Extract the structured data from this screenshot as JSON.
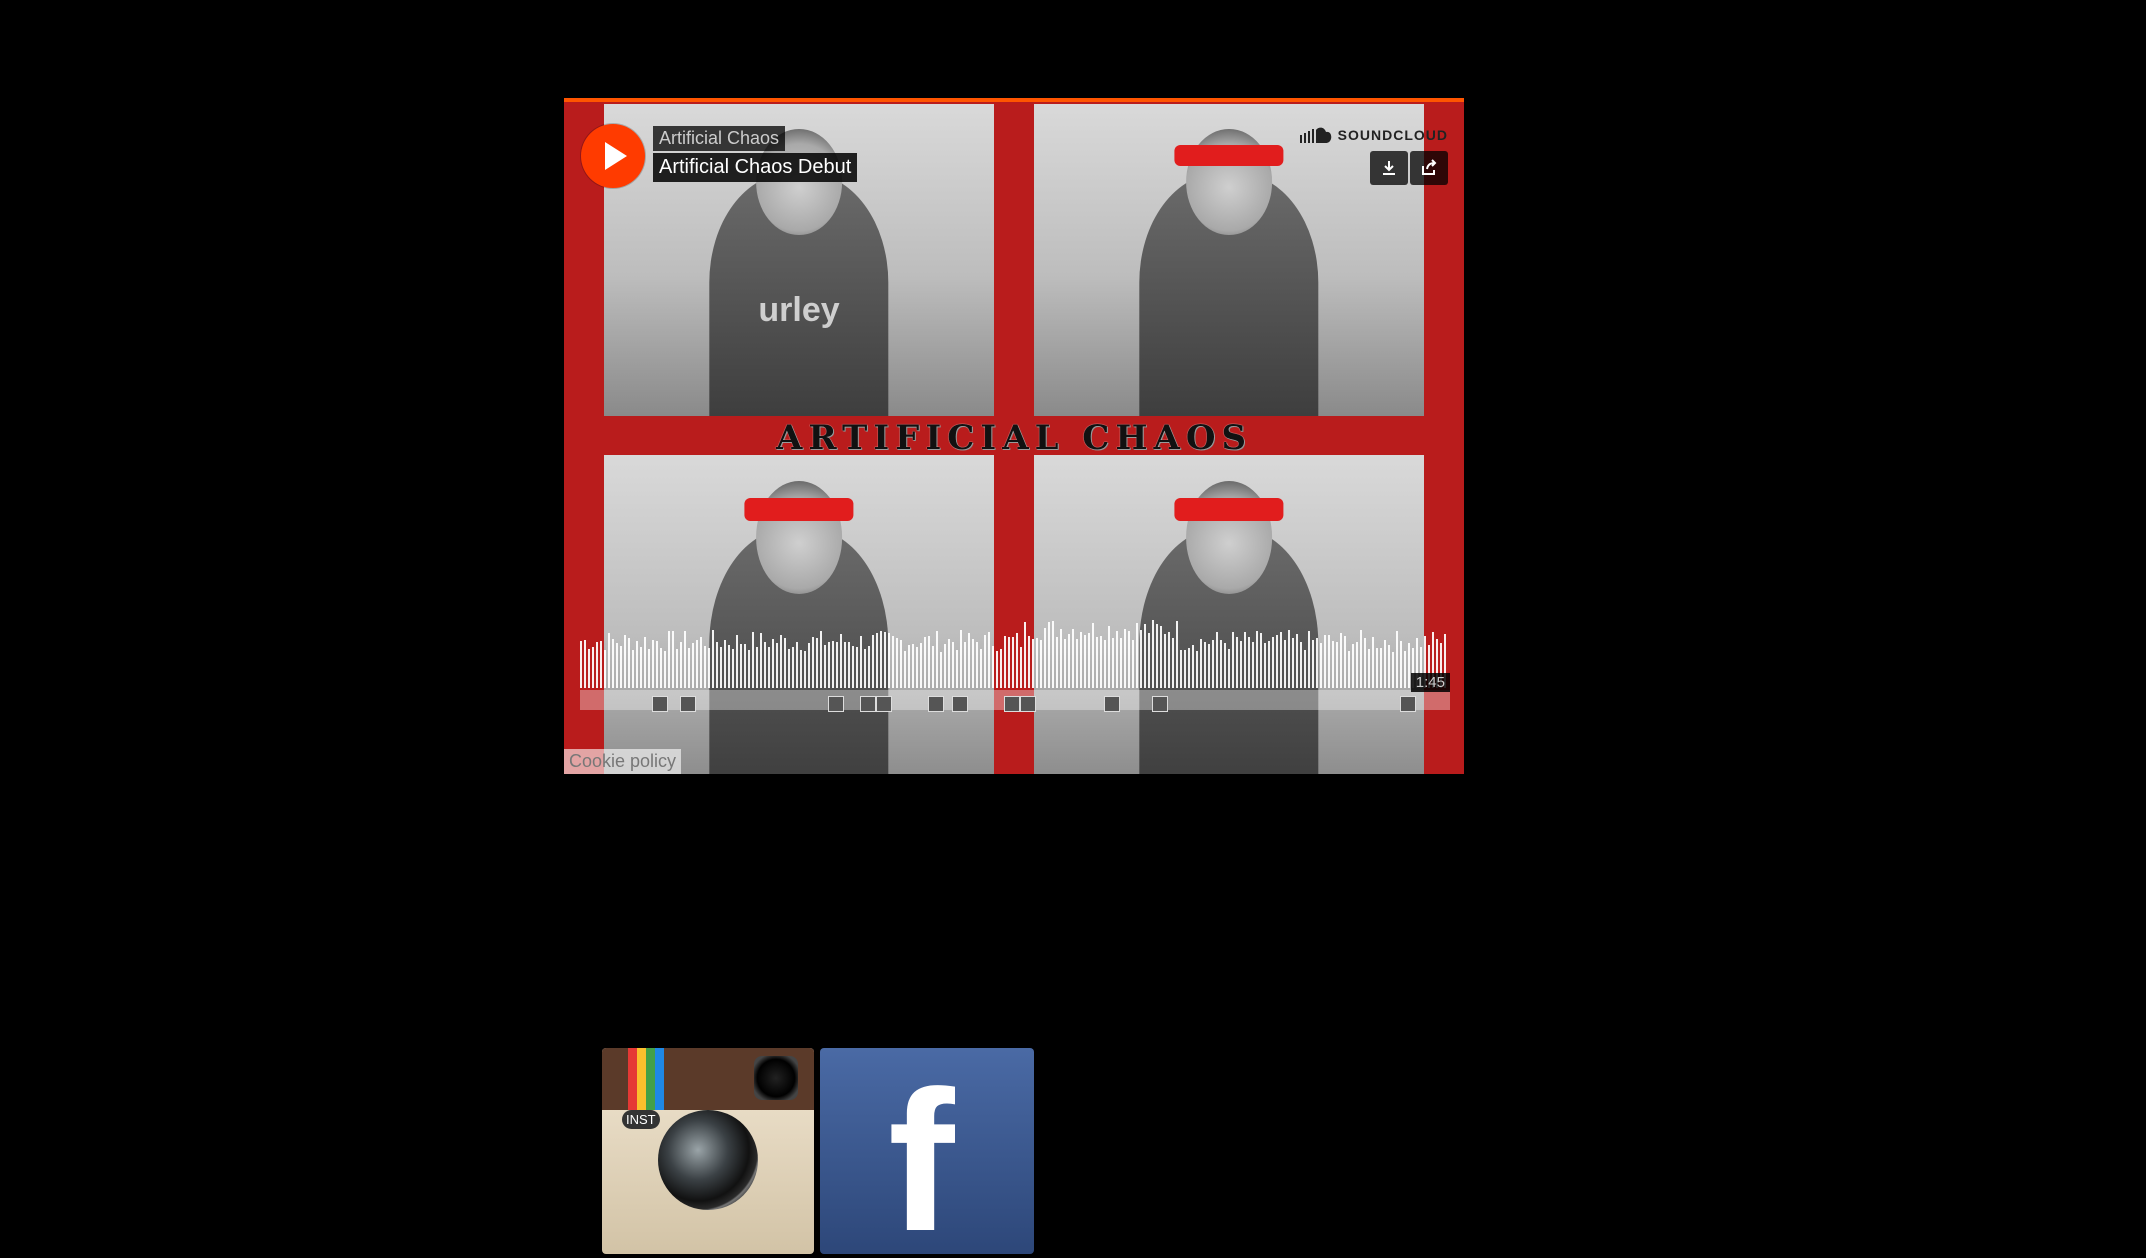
{
  "player": {
    "artist": "Artificial Chaos",
    "track_title": "Artificial Chaos Debut",
    "brand": "SOUNDCLOUD",
    "duration": "1:45",
    "cookie_policy": "Cookie policy",
    "cover_art": {
      "band_name": "ARTIFICIAL CHAOS",
      "shirt_text": "urley"
    },
    "colors": {
      "accent": "#ff5500",
      "background": "#b91c1c"
    },
    "icons": [
      "play-icon",
      "soundcloud-icon",
      "download-icon",
      "share-icon"
    ]
  },
  "social": {
    "instagram_label": "INST",
    "facebook_letter": "f",
    "icons": [
      "instagram-icon",
      "facebook-icon"
    ]
  }
}
